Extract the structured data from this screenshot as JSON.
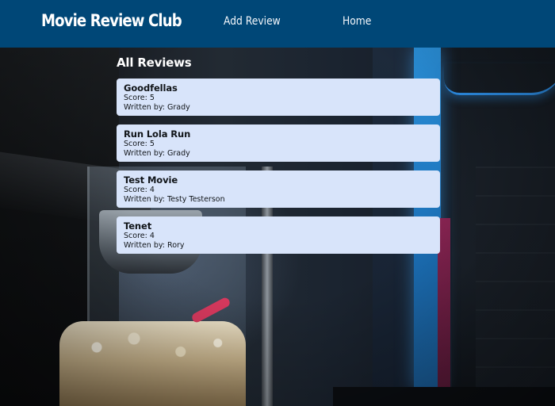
{
  "header": {
    "brand": "Movie Review Club",
    "nav": [
      {
        "label": "Add Review"
      },
      {
        "label": "Home"
      }
    ],
    "background_color": "#004777"
  },
  "main": {
    "title": "All Reviews",
    "reviews": [
      {
        "title": "Goodfellas",
        "score": "Score: 5",
        "author": "Written by: Grady"
      },
      {
        "title": "Run Lola Run",
        "score": "Score: 5",
        "author": "Written by: Grady"
      },
      {
        "title": "Test Movie",
        "score": "Score: 4",
        "author": "Written by: Testy Testerson"
      },
      {
        "title": "Tenet",
        "score": "Score: 4",
        "author": "Written by: Rory"
      }
    ],
    "card_color": "#d8e4fa"
  }
}
